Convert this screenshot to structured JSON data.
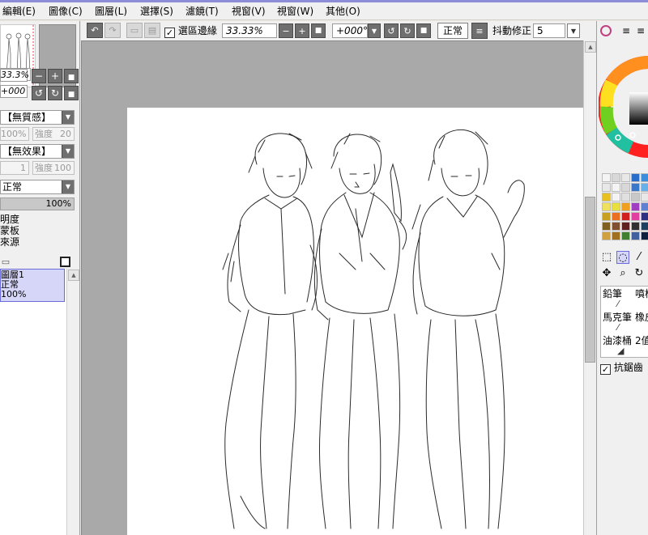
{
  "menu": [
    "編輯(E)",
    "圖像(C)",
    "圖層(L)",
    "選擇(S)",
    "濾鏡(T)",
    "視窗(V)",
    "視窗(W)",
    "其他(O)"
  ],
  "toolbar": {
    "selection_edge_label": "選區邊緣",
    "selection_edge_checked": true,
    "zoom": "33.33%",
    "rotation": "+000°",
    "blend_mode": "正常",
    "stabilizer_label": "抖動修正",
    "stabilizer_value": "5"
  },
  "navigator": {
    "zoom": "33.3%",
    "rotation": "+000"
  },
  "layer_props": {
    "texture": "【無質感】",
    "texture_amount": "100%",
    "texture_strength_label": "強度",
    "texture_strength": "20",
    "effect": "【無效果】",
    "effect_amount": "1",
    "effect_strength_label": "強度",
    "effect_strength": "100",
    "blend_mode": "正常",
    "opacity": "100%",
    "checks": [
      "明度",
      "蒙板",
      "來源"
    ]
  },
  "layers": [
    {
      "name": "圖層1",
      "mode": "正常",
      "opacity": "100%"
    }
  ],
  "colors": {
    "accent": "#8c8cd8",
    "layer_selected_bg": "#d6d6f8",
    "layer_selected_border": "#6b6bd8",
    "canvas_bg": "#a9a9a9",
    "swatches": [
      "#f4f4f4",
      "#d8d8d8",
      "#e8e8e8",
      "#2a6ecc",
      "#3c8edc",
      "#e8e8e8",
      "#f4f4f4",
      "#d8d8d8",
      "#3c78c8",
      "#6ab0e8",
      "#e8c020",
      "#f4f4f4",
      "#e0e0e0",
      "#c8c8c8",
      "#e8e8e8",
      "#f0e060",
      "#e8e040",
      "#f0a020",
      "#a040c0",
      "#6080d0",
      "#c8a020",
      "#e87020",
      "#d02020",
      "#e040a0",
      "#303080",
      "#806020",
      "#805030",
      "#602020",
      "#303030",
      "#204060",
      "#d0a040",
      "#a07020",
      "#408030",
      "#4060a0",
      "#102040"
    ]
  },
  "brushes": [
    "鉛筆",
    "噴槍",
    "馬克筆",
    "橡皮擦",
    "油漆桶",
    "2值"
  ],
  "antialias_label": "抗鋸齒",
  "antialias_checked": true
}
